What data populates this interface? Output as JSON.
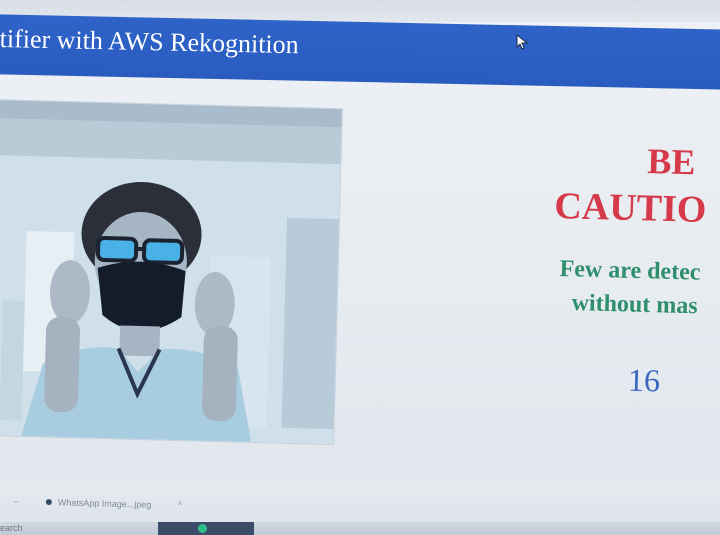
{
  "header": {
    "title": "tifier with AWS Rekognition"
  },
  "alert": {
    "line1": "BE",
    "line2": "CAUTIO",
    "detail_line1": "Few are detec",
    "detail_line2": "without mas",
    "count": "16"
  },
  "downloads": {
    "item_name": "WhatsApp Image...jpeg"
  },
  "taskbar": {
    "search_label": "earch"
  },
  "colors": {
    "header_bg": "#2f63c8",
    "alert_red": "#d63a4a",
    "detail_green": "#2f8f6c",
    "count_blue": "#3a66c0"
  }
}
